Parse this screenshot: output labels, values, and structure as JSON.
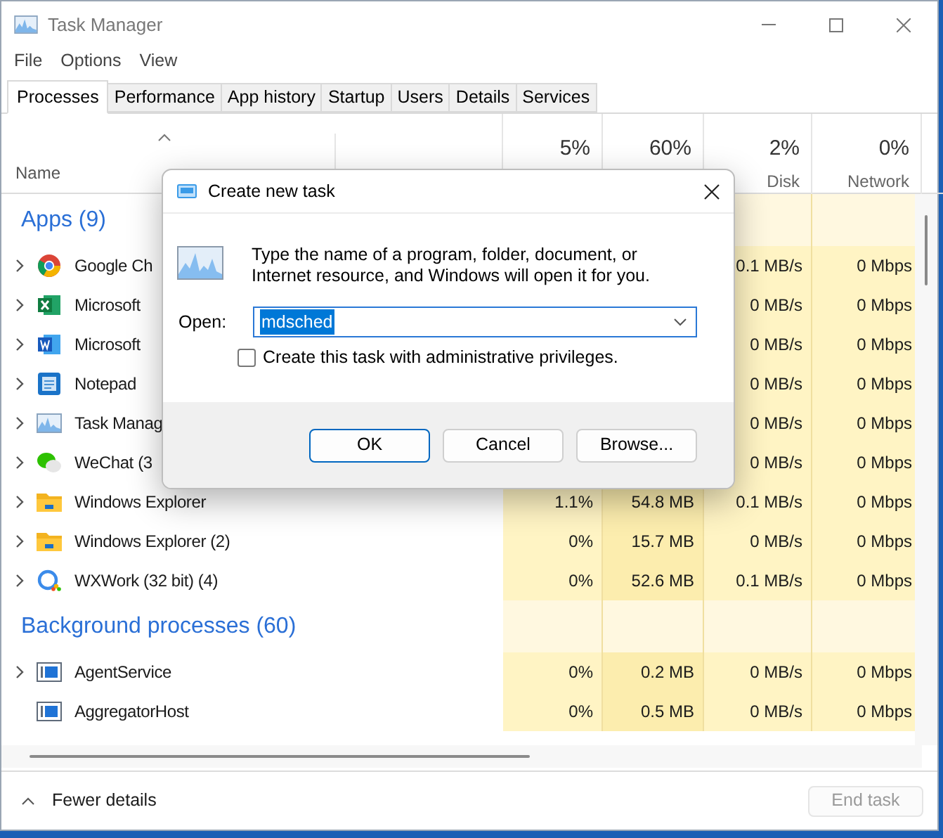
{
  "window": {
    "title": "Task Manager"
  },
  "menu": [
    "File",
    "Options",
    "View"
  ],
  "tabs": [
    {
      "label": "Processes",
      "selected": true
    },
    {
      "label": "Performance",
      "selected": false
    },
    {
      "label": "App history",
      "selected": false
    },
    {
      "label": "Startup",
      "selected": false
    },
    {
      "label": "Users",
      "selected": false
    },
    {
      "label": "Details",
      "selected": false
    },
    {
      "label": "Services",
      "selected": false
    }
  ],
  "columns": {
    "name": "Name",
    "cpu": "5%",
    "memory": "60%",
    "disk": {
      "percent": "2%",
      "label": "Disk"
    },
    "network": {
      "percent": "0%",
      "label": "Network"
    }
  },
  "groups": [
    {
      "title": "Apps (9)",
      "rows": [
        {
          "name": "Google Ch",
          "kind": "chrome",
          "expandable": true,
          "disk": "0.1 MB/s",
          "network": "0 Mbps"
        },
        {
          "name": "Microsoft",
          "kind": "excel",
          "expandable": true,
          "disk": "0 MB/s",
          "network": "0 Mbps"
        },
        {
          "name": "Microsoft",
          "kind": "word",
          "expandable": true,
          "disk": "0 MB/s",
          "network": "0 Mbps"
        },
        {
          "name": "Notepad",
          "kind": "notepad",
          "expandable": true,
          "disk": "0 MB/s",
          "network": "0 Mbps"
        },
        {
          "name": "Task Manag",
          "kind": "taskmgr",
          "expandable": true,
          "disk": "0 MB/s",
          "network": "0 Mbps"
        },
        {
          "name": "WeChat (3",
          "kind": "wechat",
          "expandable": true,
          "disk": "0 MB/s",
          "network": "0 Mbps"
        },
        {
          "name": "Windows Explorer",
          "kind": "folder",
          "expandable": true,
          "cpu": "1.1%",
          "memory": "54.8 MB",
          "disk": "0.1 MB/s",
          "network": "0 Mbps"
        },
        {
          "name": "Windows Explorer (2)",
          "kind": "folder",
          "expandable": true,
          "cpu": "0%",
          "memory": "15.7 MB",
          "disk": "0 MB/s",
          "network": "0 Mbps"
        },
        {
          "name": "WXWork (32 bit) (4)",
          "kind": "wxwork",
          "expandable": true,
          "cpu": "0%",
          "memory": "52.6 MB",
          "disk": "0.1 MB/s",
          "network": "0 Mbps"
        }
      ]
    },
    {
      "title": "Background processes (60)",
      "rows": [
        {
          "name": "AgentService",
          "kind": "service",
          "expandable": true,
          "cpu": "0%",
          "memory": "0.2 MB",
          "disk": "0 MB/s",
          "network": "0 Mbps"
        },
        {
          "name": "AggregatorHost",
          "kind": "service",
          "expandable": false,
          "cpu": "0%",
          "memory": "0.5 MB",
          "disk": "0 MB/s",
          "network": "0 Mbps"
        }
      ]
    }
  ],
  "footer": {
    "toggle": "Fewer details",
    "end_task": {
      "label": "End task",
      "disabled": true
    }
  },
  "dialog": {
    "title": "Create new task",
    "message": "Type the name of a program, folder, document, or Internet resource, and Windows will open it for you.",
    "open_label": "Open:",
    "value": "mdsched",
    "value_highlighted": true,
    "checkbox": {
      "label": "Create this task with administrative privileges.",
      "checked": false
    },
    "buttons": [
      {
        "label": "OK",
        "default": true
      },
      {
        "label": "Cancel",
        "default": false
      },
      {
        "label": "Browse...",
        "default": false
      }
    ]
  }
}
